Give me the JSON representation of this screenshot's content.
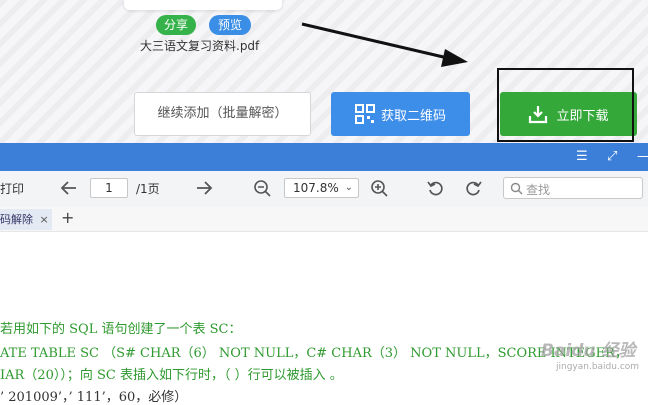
{
  "upload": {
    "share_label": "分享",
    "preview_label": "预览",
    "file_name": "大三语文复习资料.pdf"
  },
  "actions": {
    "continue_label": "继续添加（批量解密）",
    "qr_label": "获取二维码",
    "download_label": "立即下载"
  },
  "viewer": {
    "print_label": "打印",
    "page_current": "1",
    "page_total": "/1页",
    "zoom_value": "107.8%",
    "search_placeholder": "查找",
    "tab_label": "码解除",
    "tab_close": "×",
    "tab_add": "+"
  },
  "document": {
    "lines": [
      "若用如下的 SQL 语句创建了一个表 SC：",
      "ATE TABLE SC （S# CHAR（6） NOT NULL，C# CHAR（3） NOT NULL，SCORE INTEGER，",
      "IAR（20））；向 SC 表插入如下行时，（ ）行可以被插入 。",
      "’ 201009’，’ 111’，60，必修）"
    ]
  },
  "watermark": {
    "brand": "Baidu 经验",
    "url": "jingyan.baidu.com"
  },
  "colors": {
    "accent_blue": "#3d8ee9",
    "download_green": "#34a93a",
    "doc_text_green": "#2f9a2f"
  }
}
